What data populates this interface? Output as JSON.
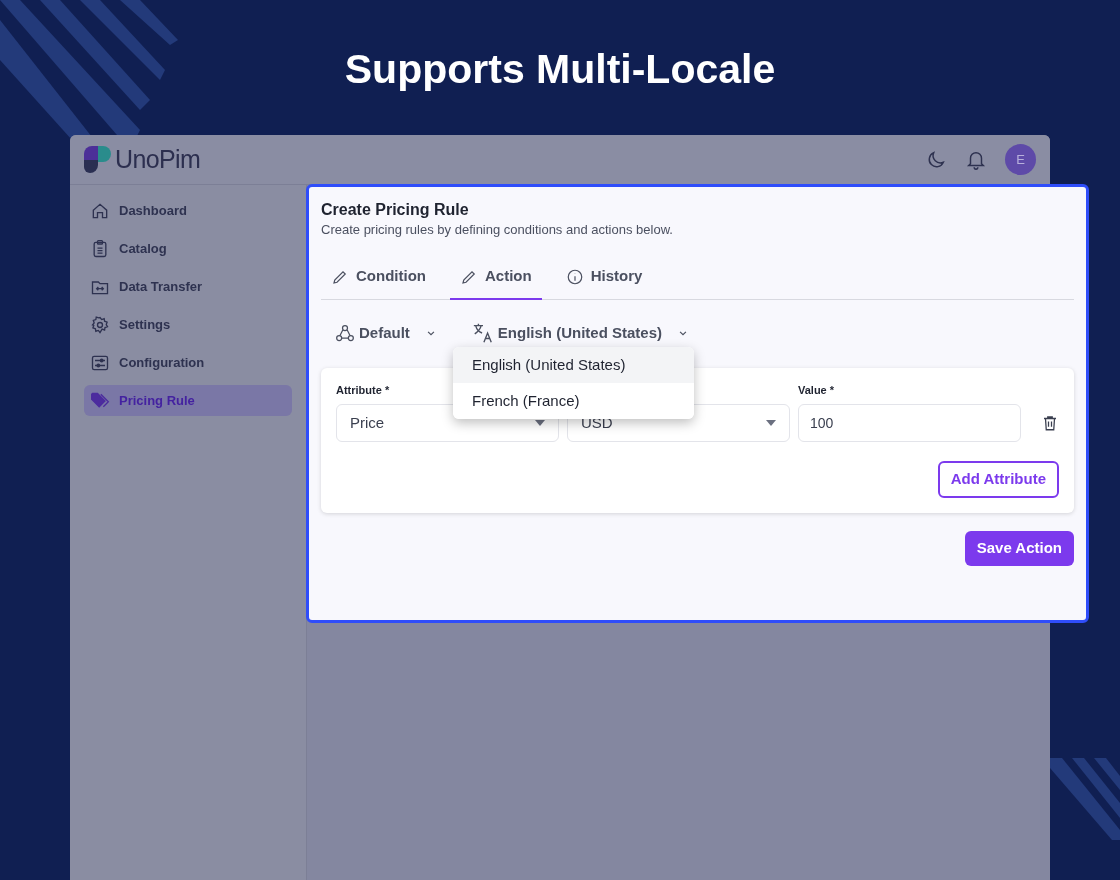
{
  "page_title": "Supports Multi-Locale",
  "app": {
    "logo_text": "UnoPim",
    "avatar_initial": "E"
  },
  "sidebar": {
    "items": [
      {
        "label": "Dashboard",
        "selected": false
      },
      {
        "label": "Catalog",
        "selected": false
      },
      {
        "label": "Data Transfer",
        "selected": false
      },
      {
        "label": "Settings",
        "selected": false
      },
      {
        "label": "Configuration",
        "selected": false
      },
      {
        "label": "Pricing Rule",
        "selected": true
      }
    ]
  },
  "modal": {
    "title": "Create Pricing Rule",
    "subtitle": "Create pricing rules by defining conditions and actions below.",
    "tabs": [
      {
        "label": "Condition",
        "selected": false
      },
      {
        "label": "Action",
        "selected": true
      },
      {
        "label": "History",
        "selected": false
      }
    ],
    "channel": "Default",
    "locale": "English (United States)",
    "locale_menu": [
      {
        "label": "English (United States)",
        "selected": true
      },
      {
        "label": "French (France)",
        "selected": false
      }
    ],
    "fields": [
      {
        "label": "Attribute *",
        "value": "Price",
        "kind": "select"
      },
      {
        "value": "USD",
        "kind": "select"
      },
      {
        "label": "Value *",
        "value": "100",
        "kind": "text"
      }
    ],
    "add_button": "Add Attribute",
    "save_button": "Save Action"
  }
}
